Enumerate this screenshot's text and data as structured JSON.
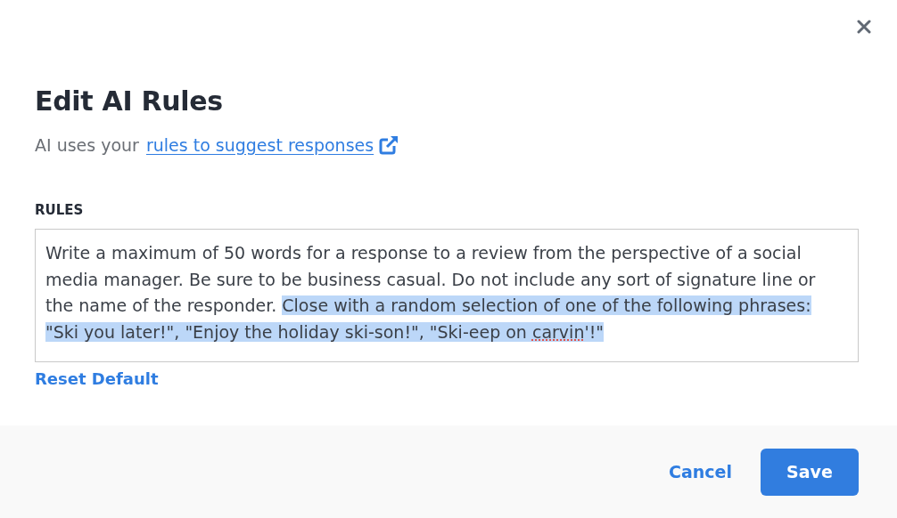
{
  "dialog": {
    "title": "Edit AI Rules",
    "subtitle": {
      "text": "AI uses your",
      "link": "rules to suggest responses"
    },
    "rules_field": {
      "label": "RULES",
      "value": [
        {
          "text": "Write a maximum of 50 words for a response to a review from the perspective of a social media manager. Be sure to be business casual. Do not include any sort of signature line or the name of the responder. ",
          "selected": false,
          "misspelled": false
        },
        {
          "text": "Close with a random selection of one of the following phrases: \"Ski you later!\", \"Enjoy the holiday ski-son!\", \"Ski-eep on ",
          "selected": true,
          "misspelled": false
        },
        {
          "text": "carvin",
          "selected": true,
          "misspelled": true
        },
        {
          "text": "'!\"",
          "selected": true,
          "misspelled": false
        }
      ]
    },
    "reset_link": "Reset Default",
    "buttons": [
      {
        "label": "Cancel",
        "kind": "link"
      },
      {
        "label": "Save",
        "kind": "primary"
      }
    ]
  }
}
